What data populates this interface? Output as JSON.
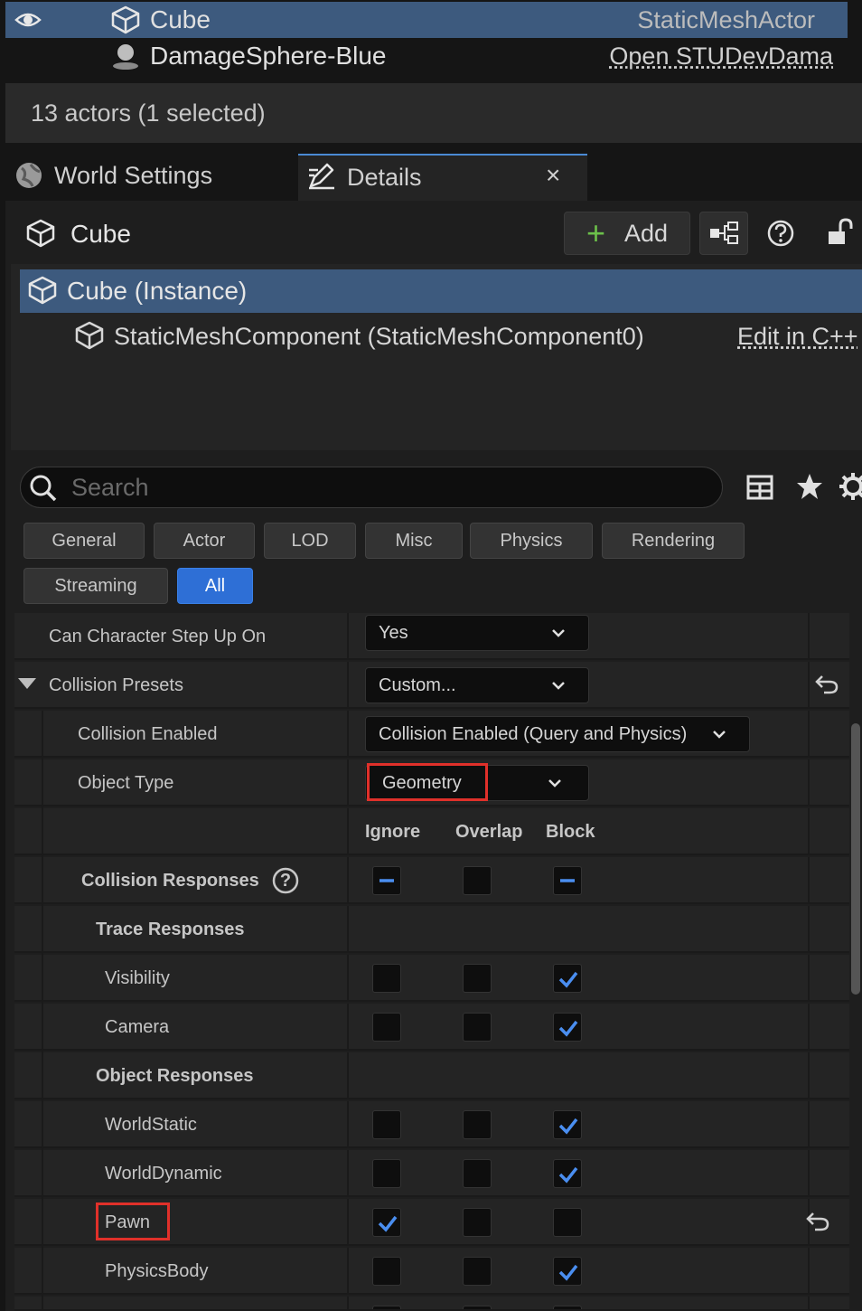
{
  "outliner": {
    "rows": [
      {
        "name": "Cube",
        "type": "StaticMeshActor"
      },
      {
        "name": "DamageSphere-Blue",
        "type": "Open STUDevDama"
      }
    ],
    "status": "13 actors (1 selected)"
  },
  "tabs": {
    "world_settings": "World Settings",
    "details": "Details",
    "close_glyph": "×"
  },
  "details": {
    "actor_name": "Cube",
    "add_label": "Add",
    "add_glyph": "+",
    "instance_label": "Cube (Instance)",
    "component_label": "StaticMeshComponent (StaticMeshComponent0)",
    "edit_cpp_label": "Edit in C++",
    "search_placeholder": "Search",
    "categories": [
      "General",
      "Actor",
      "LOD",
      "Misc",
      "Physics",
      "Rendering",
      "Streaming",
      "All"
    ],
    "active_category": "All"
  },
  "properties": {
    "step_up": {
      "label": "Can Character Step Up On",
      "value": "Yes"
    },
    "presets": {
      "label": "Collision Presets",
      "value": "Custom..."
    },
    "enabled": {
      "label": "Collision Enabled",
      "value": "Collision Enabled (Query and Physics)"
    },
    "object_type": {
      "label": "Object Type",
      "value": "Geometry"
    },
    "columns": {
      "ignore": "Ignore",
      "overlap": "Overlap",
      "block": "Block"
    },
    "collision_responses": {
      "label": "Collision Responses",
      "help_glyph": "?"
    },
    "trace_responses": "Trace Responses",
    "object_responses": "Object Responses",
    "responses": [
      {
        "label": "Visibility",
        "response": "Block"
      },
      {
        "label": "Camera",
        "response": "Block"
      },
      {
        "label": "WorldStatic",
        "response": "Block"
      },
      {
        "label": "WorldDynamic",
        "response": "Block"
      },
      {
        "label": "Pawn",
        "response": "Ignore"
      },
      {
        "label": "PhysicsBody",
        "response": "Block"
      }
    ]
  },
  "colors": {
    "selection": "#3d5a7e",
    "accent_blue": "#2e6fd6",
    "check_blue": "#4a8ef0",
    "highlight_red": "#e0302a",
    "add_green": "#6cc04a"
  }
}
